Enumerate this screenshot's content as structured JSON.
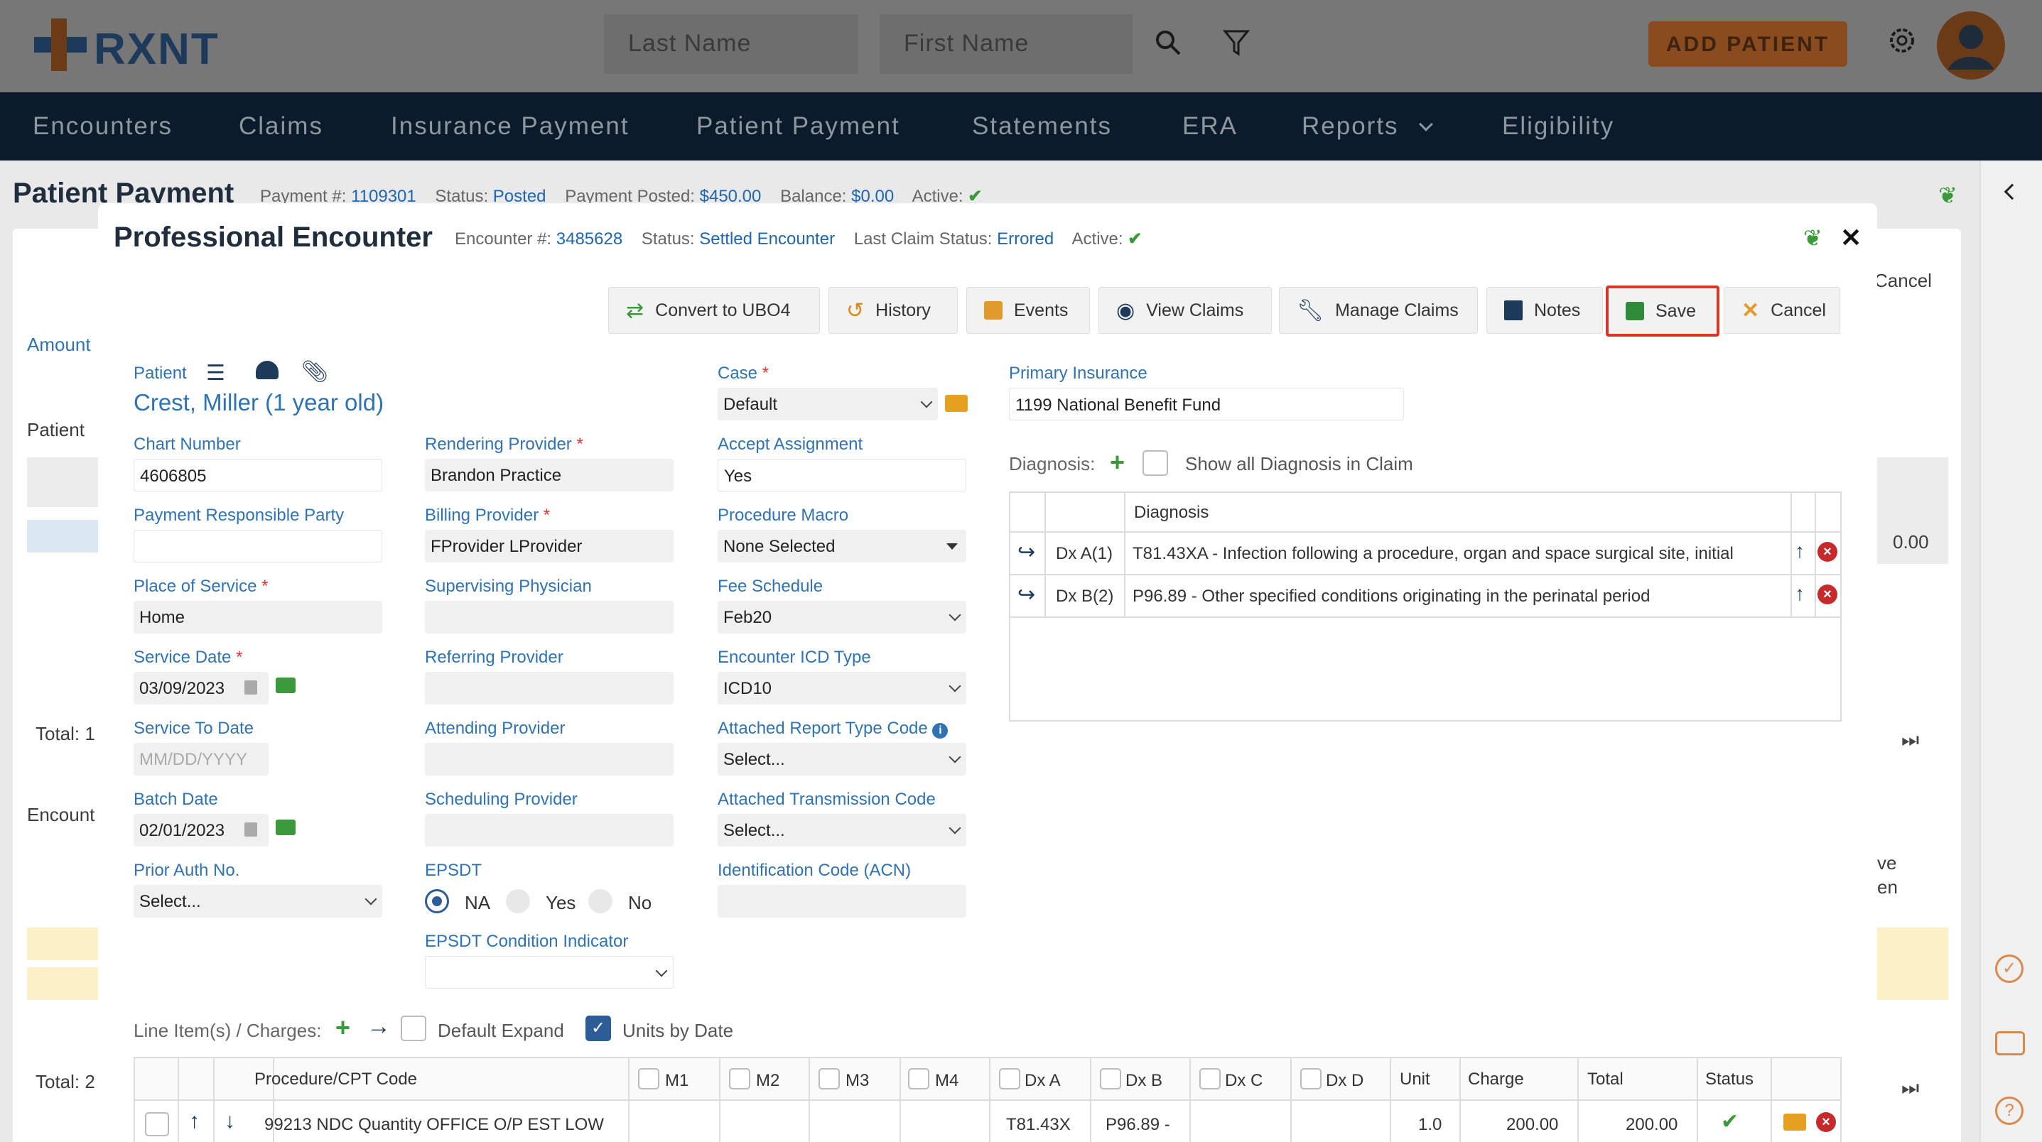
{
  "app": {
    "logo": "RXNT"
  },
  "header": {
    "last_name_placeholder": "Last Name",
    "first_name_placeholder": "First Name",
    "add_patient": "ADD PATIENT"
  },
  "nav": [
    "Encounters",
    "Claims",
    "Insurance Payment",
    "Patient Payment",
    "Statements",
    "ERA",
    "Reports",
    "Eligibility"
  ],
  "page": {
    "title": "Patient Payment",
    "payment_no_label": "Payment #:",
    "payment_no": "1109301",
    "status_label": "Status:",
    "status": "Posted",
    "posted_label": "Payment Posted:",
    "posted": "$450.00",
    "balance_label": "Balance:",
    "balance": "$0.00",
    "active_label": "Active:",
    "bg_amount": "Amount",
    "bg_patient": "Patient",
    "bg_total1": "Total: 1",
    "bg_encount": "Encount",
    "bg_total2": "Total: 2",
    "bg_cancel": "Cancel",
    "bg_value": "0.00",
    "bg_ve": "ve",
    "bg_en": "en"
  },
  "encounter": {
    "title": "Professional Encounter",
    "enc_no_label": "Encounter #:",
    "enc_no": "3485628",
    "status_label": "Status:",
    "status": "Settled Encounter",
    "last_claim_label": "Last Claim Status:",
    "last_claim": "Errored",
    "active_label": "Active:",
    "toolbar": {
      "convert": "Convert to UBO4",
      "history": "History",
      "events": "Events",
      "view_claims": "View Claims",
      "manage_claims": "Manage Claims",
      "notes": "Notes",
      "save": "Save",
      "cancel": "Cancel"
    },
    "patient_label": "Patient",
    "patient_name": "Crest, Miller (1 year old)",
    "chart_number_label": "Chart Number",
    "chart_number": "4606805",
    "payment_party_label": "Payment Responsible Party",
    "payment_party": "",
    "place_label": "Place of Service",
    "place": "Home",
    "service_date_label": "Service Date",
    "service_date": "03/09/2023",
    "service_to_label": "Service To Date",
    "service_to_placeholder": "MM/DD/YYYY",
    "batch_date_label": "Batch Date",
    "batch_date": "02/01/2023",
    "prior_auth_label": "Prior Auth No.",
    "prior_auth": "Select...",
    "rendering_label": "Rendering Provider",
    "rendering": "Brandon Practice",
    "billing_label": "Billing Provider",
    "billing": "FProvider LProvider",
    "supervising_label": "Supervising Physician",
    "referring_label": "Referring Provider",
    "attending_label": "Attending Provider",
    "scheduling_label": "Scheduling Provider",
    "epsdt_label": "EPSDT",
    "epsdt_options": [
      "NA",
      "Yes",
      "No"
    ],
    "epsdt_selected": "NA",
    "epsdt_cond_label": "EPSDT Condition Indicator",
    "case_label": "Case",
    "case": "Default",
    "accept_label": "Accept Assignment",
    "accept": "Yes",
    "macro_label": "Procedure Macro",
    "macro": "None Selected",
    "fee_label": "Fee Schedule",
    "fee": "Feb20",
    "icd_label": "Encounter ICD Type",
    "icd": "ICD10",
    "report_type_label": "Attached Report Type Code",
    "report_type": "Select...",
    "transmission_label": "Attached Transmission Code",
    "transmission": "Select...",
    "acn_label": "Identification Code (ACN)",
    "primary_ins_label": "Primary Insurance",
    "primary_ins": "1199 National Benefit Fund",
    "diagnosis_label": "Diagnosis:",
    "show_all_diag": "Show all Diagnosis in Claim",
    "diag_header": "Diagnosis",
    "diagnoses": [
      {
        "code": "Dx A(1)",
        "text": "T81.43XA - Infection following a procedure, organ and space surgical site, initial"
      },
      {
        "code": "Dx B(2)",
        "text": "P96.89 - Other specified conditions originating in the perinatal period"
      }
    ],
    "line_items_label": "Line Item(s) / Charges:",
    "default_expand": "Default Expand",
    "units_by_date": "Units by Date",
    "columns": [
      "Procedure/CPT Code",
      "M1",
      "M2",
      "M3",
      "M4",
      "Dx A",
      "Dx B",
      "Dx C",
      "Dx D",
      "Unit",
      "Charge",
      "Total",
      "Status"
    ],
    "line": {
      "cpt": "99213 NDC Quantity OFFICE O/P EST LOW",
      "dxa": "T81.43X",
      "dxb": "P96.89 -",
      "unit": "1.0",
      "charge": "200.00",
      "total": "200.00"
    }
  }
}
